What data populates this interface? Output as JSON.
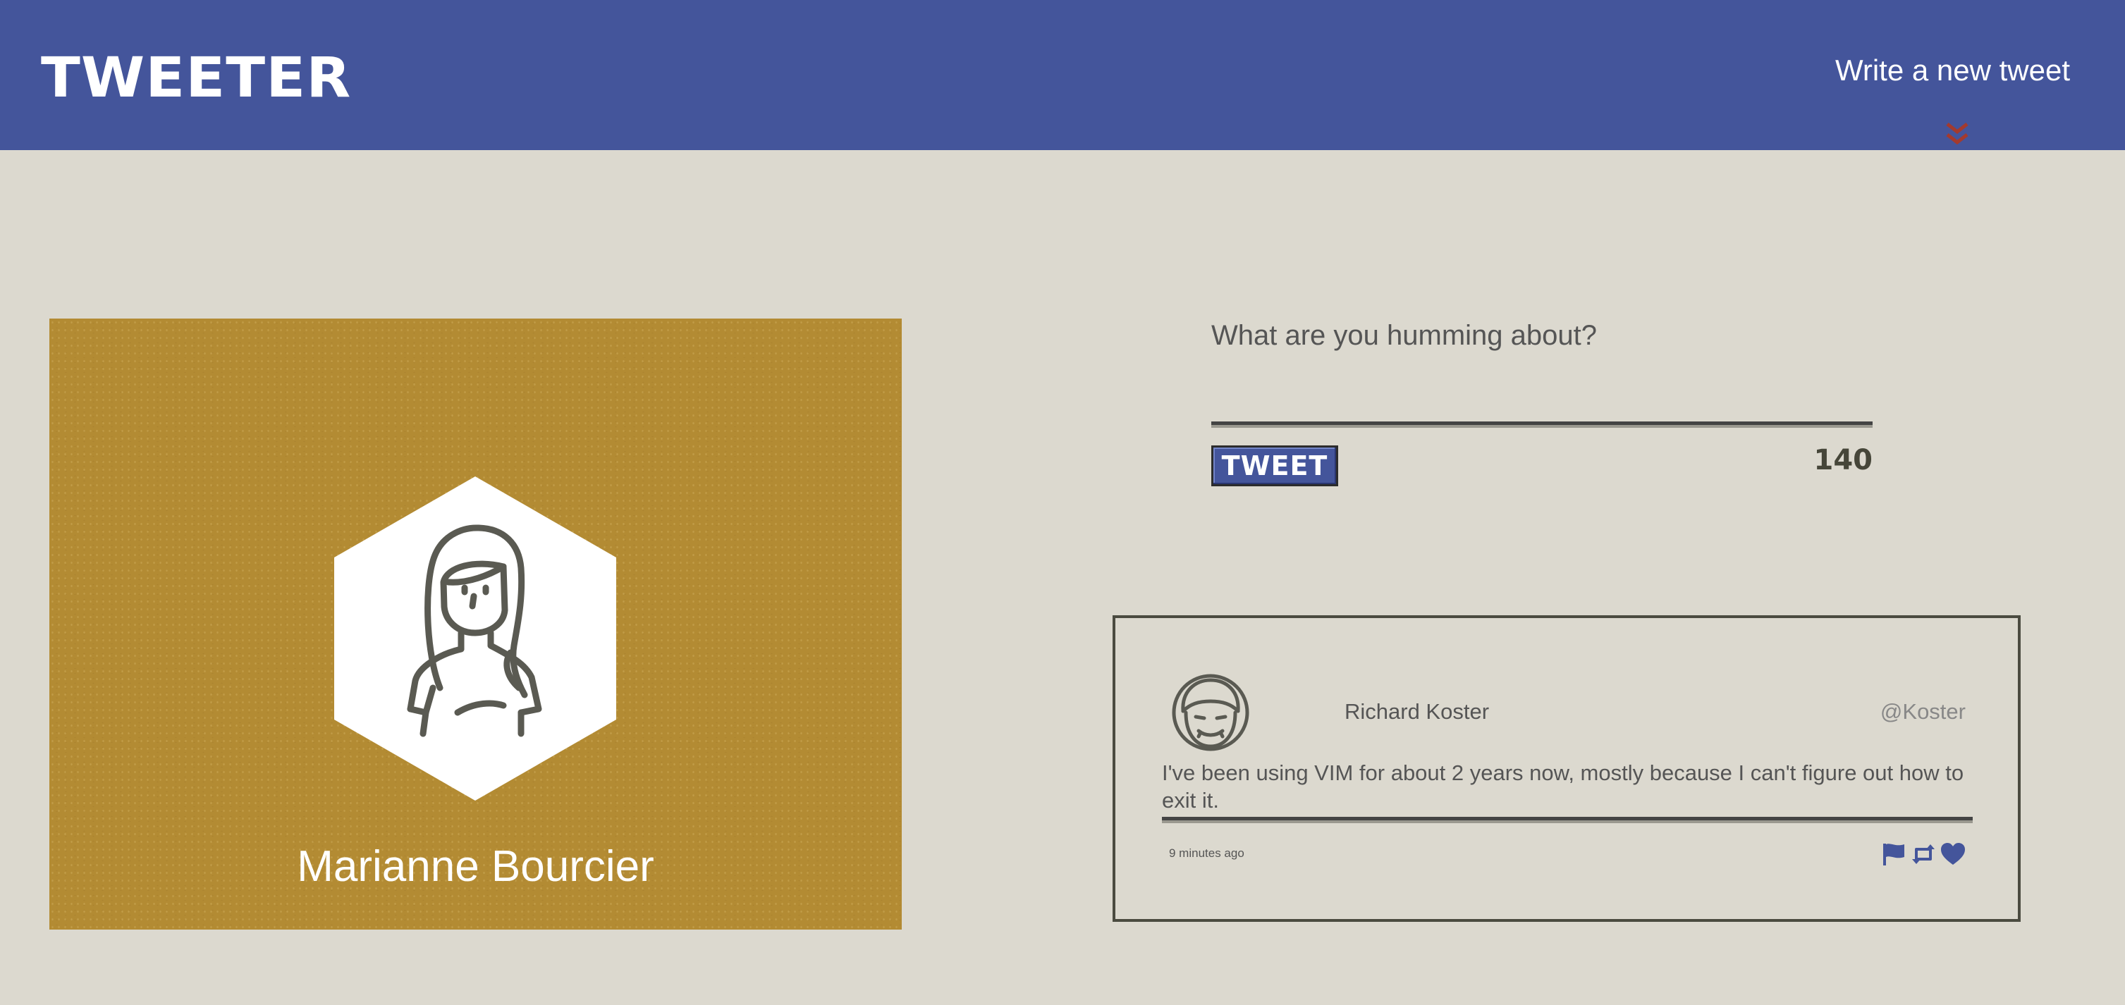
{
  "header": {
    "brand": "TWEETER",
    "compose_link": "Write a new tweet",
    "toggle_icon": "double-chevron-down-icon",
    "colors": {
      "bar": "#44559b",
      "chevron": "#a33a2e"
    }
  },
  "profile": {
    "name": "Marianne Bourcier",
    "avatar_icon": "woman-avatar-icon",
    "background_color": "#b38b33"
  },
  "compose": {
    "placeholder": "What are you humming about?",
    "button_label": "TWEET",
    "counter": "140"
  },
  "tweets": [
    {
      "author": "Richard Koster",
      "handle": "@Koster",
      "avatar_icon": "man-avatar-icon",
      "text": "I've been using VIM for about 2 years now, mostly because I can't figure out how to exit it.",
      "timestamp": "9 minutes ago",
      "actions": [
        "flag-icon",
        "retweet-icon",
        "heart-icon"
      ]
    }
  ]
}
